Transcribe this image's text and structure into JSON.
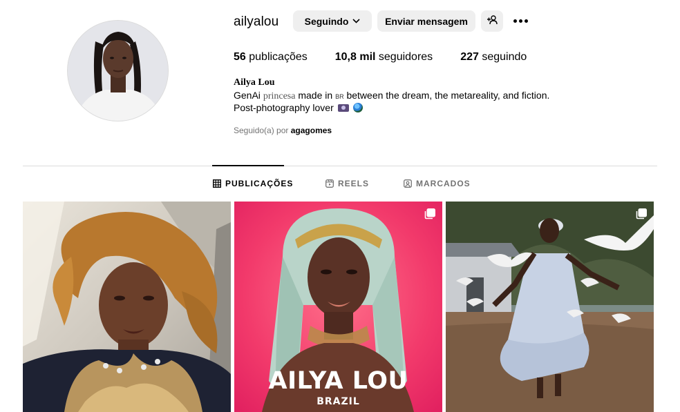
{
  "profile": {
    "username": "ailyalou",
    "buttons": {
      "following": "Seguindo",
      "message": "Enviar mensagem"
    },
    "stats": {
      "posts_value": "56",
      "posts_label": "publicações",
      "followers_value": "10,8 mil",
      "followers_label": "seguidores",
      "following_value": "227",
      "following_label": "seguindo"
    },
    "full_name": "Ailya Lou",
    "bio": {
      "line1_a": "GenAi ",
      "line1_styled": "princesa",
      "line1_b": " made in ",
      "line1_small": "BR",
      "line1_c": " between the dream, the metareality, and fiction.",
      "line2": "Post-photography lover"
    },
    "followed_by_prefix": "Seguido(a) por",
    "followed_by_user": "agagomes"
  },
  "tabs": [
    {
      "label": "PUBLICAÇÕES",
      "icon": "grid-icon",
      "active": true
    },
    {
      "label": "REELS",
      "icon": "reels-icon",
      "active": false
    },
    {
      "label": "MARCADOS",
      "icon": "tagged-icon",
      "active": false
    }
  ],
  "posts": [
    {
      "type": "image",
      "multi": false
    },
    {
      "type": "carousel",
      "multi": true,
      "title": "AILYA LOU",
      "subtitle": "BRAZIL"
    },
    {
      "type": "carousel",
      "multi": true
    }
  ],
  "colors": {
    "button_bg": "#efefef",
    "muted_text": "#737373",
    "divider": "#dbdbdb"
  }
}
